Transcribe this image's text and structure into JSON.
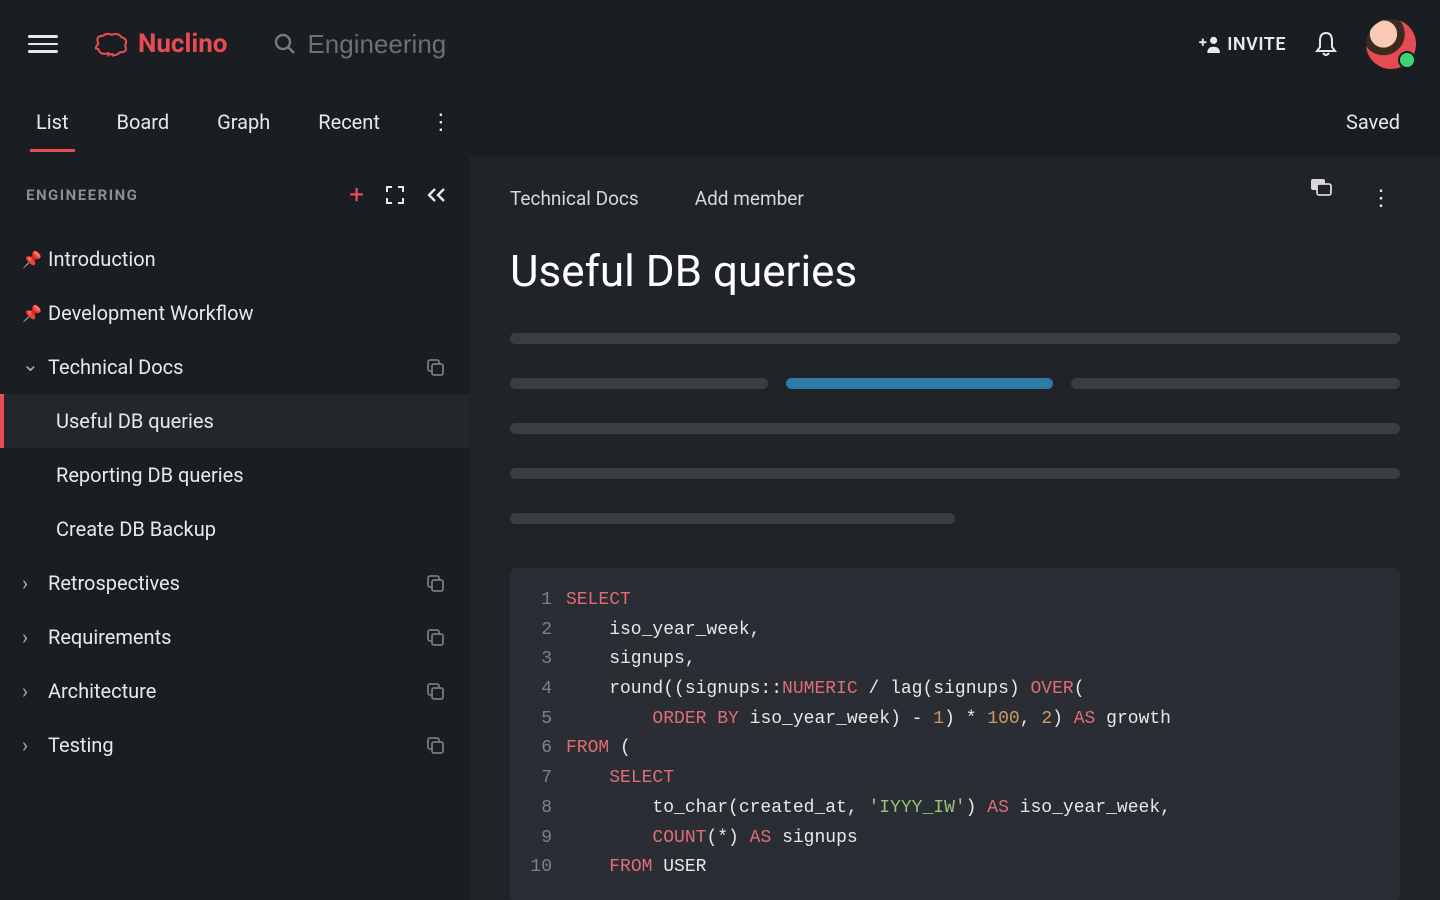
{
  "brand": {
    "name": "Nuclino"
  },
  "search": {
    "placeholder": "Engineering"
  },
  "topbar": {
    "invite": "INVITE"
  },
  "view": {
    "tabs": [
      "List",
      "Board",
      "Graph",
      "Recent"
    ],
    "active_index": 0,
    "status": "Saved"
  },
  "sidebar": {
    "title": "ENGINEERING",
    "items": [
      {
        "kind": "pinned",
        "label": "Introduction"
      },
      {
        "kind": "pinned",
        "label": "Development Workflow"
      },
      {
        "kind": "folder-open",
        "label": "Technical Docs",
        "copy": true,
        "children": [
          {
            "label": "Useful DB queries",
            "active": true
          },
          {
            "label": "Reporting DB queries"
          },
          {
            "label": "Create DB Backup"
          }
        ]
      },
      {
        "kind": "folder",
        "label": "Retrospectives",
        "copy": true
      },
      {
        "kind": "folder",
        "label": "Requirements",
        "copy": true
      },
      {
        "kind": "folder",
        "label": "Architecture",
        "copy": true
      },
      {
        "kind": "folder",
        "label": "Testing",
        "copy": true
      }
    ]
  },
  "doc": {
    "breadcrumbs": [
      "Technical Docs",
      "Add member"
    ],
    "title": "Useful DB queries",
    "code_lines": [
      [
        {
          "t": "SELECT",
          "c": "kw"
        }
      ],
      [
        {
          "t": "    iso_year_week,",
          "c": "id"
        }
      ],
      [
        {
          "t": "    signups,",
          "c": "id"
        }
      ],
      [
        {
          "t": "    round((signups::",
          "c": "id"
        },
        {
          "t": "NUMERIC",
          "c": "kw"
        },
        {
          "t": " / lag(signups) ",
          "c": "id"
        },
        {
          "t": "OVER",
          "c": "kw"
        },
        {
          "t": "(",
          "c": "id"
        }
      ],
      [
        {
          "t": "        ",
          "c": "id"
        },
        {
          "t": "ORDER BY",
          "c": "kw"
        },
        {
          "t": " iso_year_week) - ",
          "c": "id"
        },
        {
          "t": "1",
          "c": "num"
        },
        {
          "t": ") * ",
          "c": "id"
        },
        {
          "t": "100",
          "c": "num"
        },
        {
          "t": ", ",
          "c": "id"
        },
        {
          "t": "2",
          "c": "num"
        },
        {
          "t": ") ",
          "c": "id"
        },
        {
          "t": "AS",
          "c": "kw"
        },
        {
          "t": " growth",
          "c": "id"
        }
      ],
      [
        {
          "t": "FROM",
          "c": "kw"
        },
        {
          "t": " (",
          "c": "id"
        }
      ],
      [
        {
          "t": "    ",
          "c": "id"
        },
        {
          "t": "SELECT",
          "c": "kw"
        }
      ],
      [
        {
          "t": "        to_char(created_at, ",
          "c": "id"
        },
        {
          "t": "'IYYY_IW'",
          "c": "str"
        },
        {
          "t": ") ",
          "c": "id"
        },
        {
          "t": "AS",
          "c": "kw"
        },
        {
          "t": " iso_year_week,",
          "c": "id"
        }
      ],
      [
        {
          "t": "        ",
          "c": "id"
        },
        {
          "t": "COUNT",
          "c": "kw"
        },
        {
          "t": "(*) ",
          "c": "id"
        },
        {
          "t": "AS",
          "c": "kw"
        },
        {
          "t": " signups",
          "c": "id"
        }
      ],
      [
        {
          "t": "    ",
          "c": "id"
        },
        {
          "t": "FROM",
          "c": "kw"
        },
        {
          "t": " ",
          "c": "id"
        },
        {
          "t": "USER",
          "c": "fn"
        }
      ]
    ]
  }
}
